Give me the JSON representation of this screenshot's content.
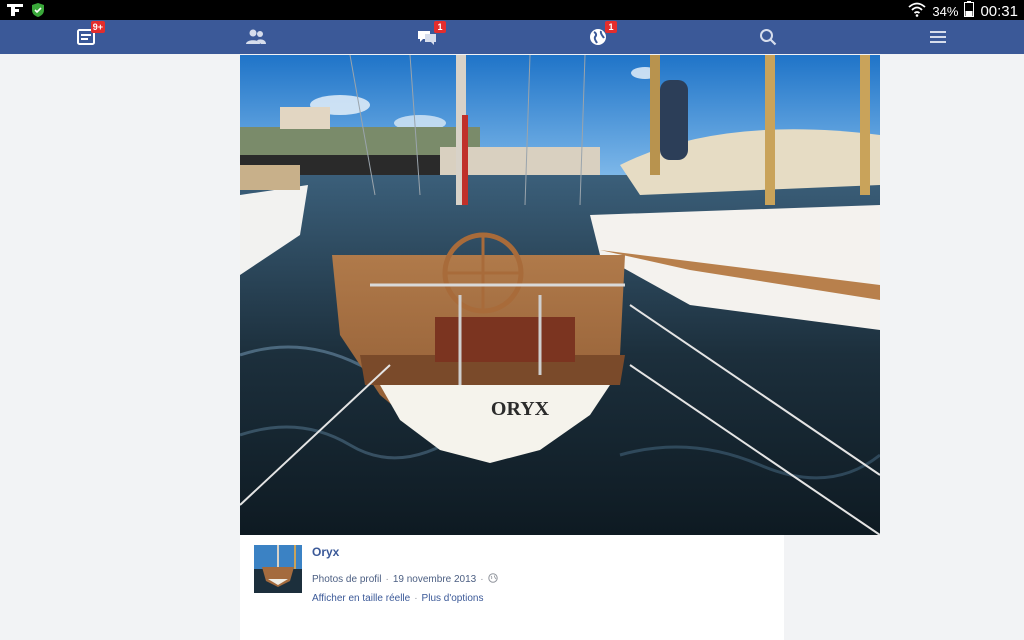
{
  "status_bar": {
    "battery_percent": "34%",
    "clock": "00:31"
  },
  "nav": {
    "news_feed_badge": "9+",
    "friend_requests_badge": "",
    "messages_badge": "1",
    "notifications_badge": "1"
  },
  "photo": {
    "boat_name": "ORYX"
  },
  "post": {
    "title": "Oryx",
    "album": "Photos de profil",
    "separator": "·",
    "date": "19 novembre 2013",
    "view_full_size": "Afficher en taille réelle",
    "more_options": "Plus d'options"
  },
  "colors": {
    "navbar": "#3b5998",
    "badge": "#e32d2d",
    "link": "#3b5998"
  }
}
